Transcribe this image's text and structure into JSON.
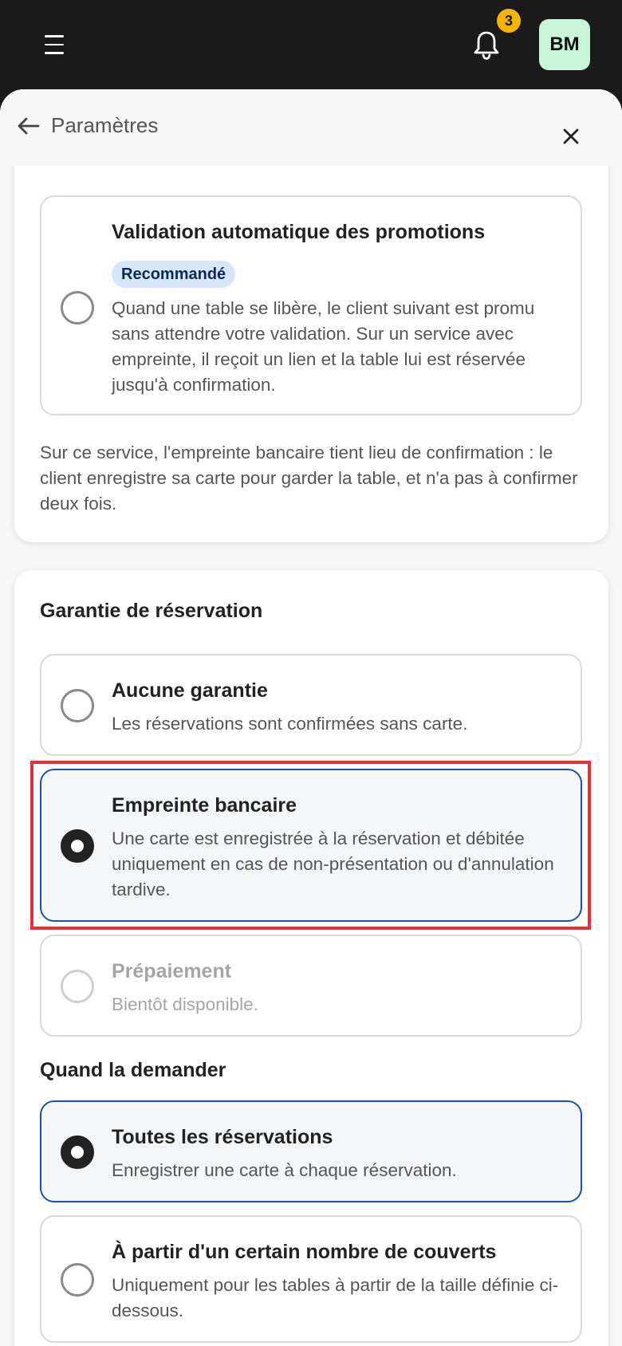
{
  "topbar": {
    "notification_count": "3",
    "avatar_initials": "BM"
  },
  "sheet": {
    "title": "Paramètres"
  },
  "promotions": {
    "option": {
      "title": "Validation automatique des promotions",
      "badge": "Recommandé",
      "description": "Quand une table se libère, le client suivant est promu sans attendre votre validation. Sur un service avec empreinte, il reçoit un lien et la table lui est réservée jusqu'à confirmation."
    },
    "info": "Sur ce service, l'empreinte bancaire tient lieu de confirmation : le client enregistre sa carte pour garder la table, et n'a pas à confirmer deux fois."
  },
  "guarantee": {
    "section_title": "Garantie de réservation",
    "options": [
      {
        "title": "Aucune garantie",
        "description": "Les réservations sont confirmées sans carte."
      },
      {
        "title": "Empreinte bancaire",
        "description": "Une carte est enregistrée à la réservation et débitée uniquement en cas de non-présentation ou d'annulation tardive."
      },
      {
        "title": "Prépaiement",
        "description": "Bientôt disponible."
      }
    ],
    "selected": "Empreinte bancaire"
  },
  "when": {
    "section_title": "Quand la demander",
    "options": [
      {
        "title": "Toutes les réservations",
        "description": "Enregistrer une carte à chaque réservation."
      },
      {
        "title": "À partir d'un certain nombre de couverts",
        "description": "Uniquement pour les tables à partir de la taille définie ci-dessous."
      }
    ],
    "selected": "Toutes les réservations"
  },
  "colors": {
    "selected_border": "#1b4fa8",
    "highlight": "#e0323c",
    "badge": "#f4b400",
    "avatar_bg": "#c9f5dd",
    "pill_bg": "#d7e6fb"
  }
}
